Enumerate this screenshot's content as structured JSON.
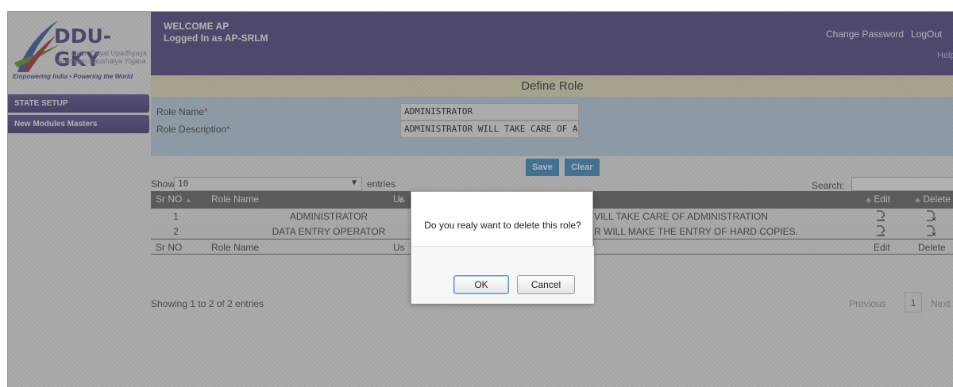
{
  "logo": {
    "name": "DDU-GKY",
    "sub_line1": "Deen Dayal Upadhyaya",
    "sub_line2": "Grameen Kaushalya Yojana",
    "tagline": "Empowering India • Powering the World"
  },
  "header": {
    "welcome": "WELCOME  AP",
    "logged_in": "Logged In as  AP-SRLM",
    "change_password": "Change Password",
    "logout": "LogOut",
    "help": "Help"
  },
  "page_title": "Define Role",
  "sidebar": {
    "items": [
      {
        "label": "STATE SETUP"
      },
      {
        "label": "New Modules Masters"
      }
    ]
  },
  "form": {
    "role_name_label": "Role Name",
    "role_desc_label": "Role Description",
    "required_mark": "*",
    "role_name_value": "ADMINISTRATOR",
    "role_desc_value": "ADMINISTRATOR WILL TAKE CARE OF A",
    "save_label": "Save",
    "clear_label": "Clear"
  },
  "table_controls": {
    "show_label": "Show",
    "page_size": "10",
    "entries_label": "entries",
    "search_label": "Search:"
  },
  "table": {
    "headers": {
      "sr": "Sr NO",
      "name": "Role Name",
      "desc": "Us",
      "edit": "Edit",
      "delete": "Delete"
    },
    "rows": [
      {
        "sr": "1",
        "name": "ADMINISTRATOR",
        "desc": "VILL TAKE CARE OF ADMINISTRATION"
      },
      {
        "sr": "2",
        "name": "DATA ENTRY OPERATOR",
        "desc": "R WILL MAKE THE ENTRY OF HARD COPIES."
      }
    ]
  },
  "footer": {
    "info": "Showing 1 to 2 of 2 entries",
    "previous": "Previous",
    "current_page": "1",
    "next": "Next"
  },
  "dialog": {
    "message": "Do you realy want to delete this role?",
    "ok": "OK",
    "cancel": "Cancel"
  },
  "colors": {
    "header_bg": "#5a4e8e",
    "title_bg": "#f0e8c8",
    "form_bg": "#c6dbea",
    "button_blue": "#3f93c8",
    "table_header": "#6b6b6b"
  }
}
